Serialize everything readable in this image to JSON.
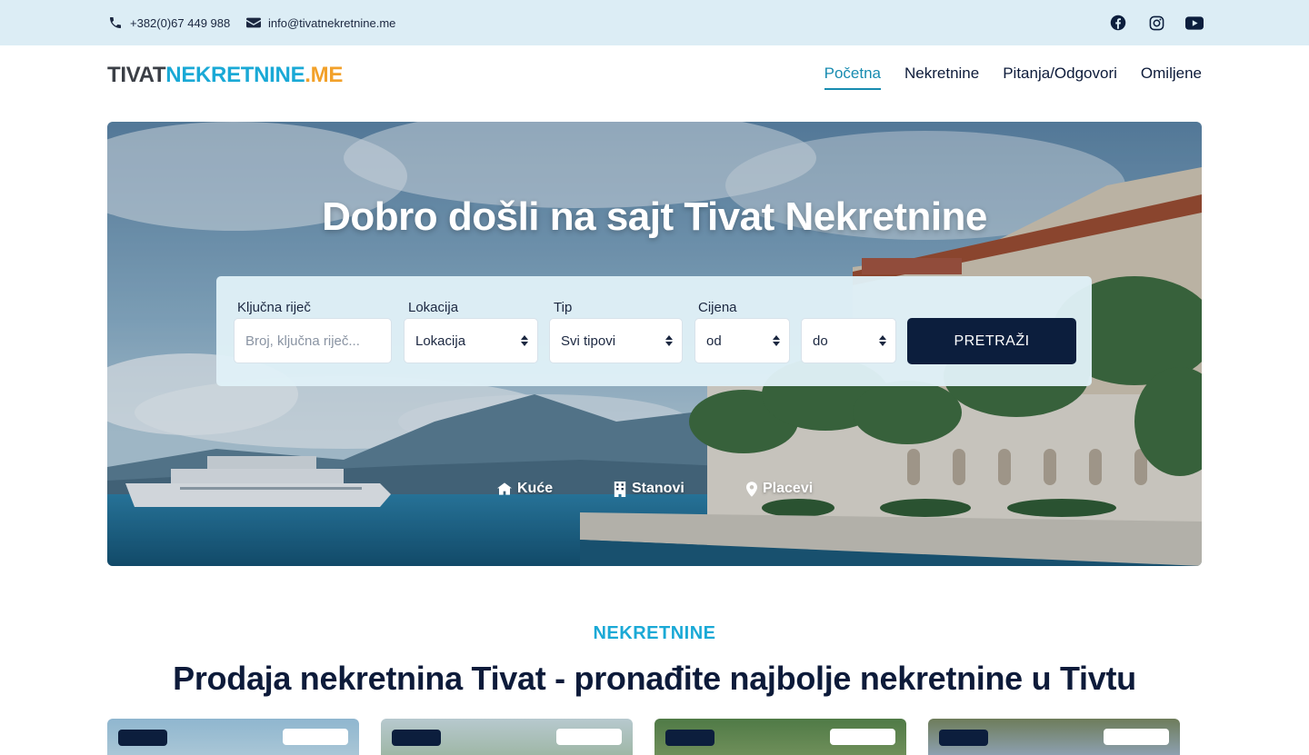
{
  "topbar": {
    "phone": "+382(0)67 449 988",
    "email": "info@tivatnekretnine.me",
    "socials": [
      "facebook-icon",
      "instagram-icon",
      "youtube-icon"
    ]
  },
  "header": {
    "logo": {
      "part1": "TIVAT",
      "part2": "NEKRETNINE",
      "part3": ".ME"
    },
    "nav": [
      {
        "label": "Početna",
        "active": true
      },
      {
        "label": "Nekretnine",
        "active": false
      },
      {
        "label": "Pitanja/Odgovori",
        "active": false
      },
      {
        "label": "Omiljene",
        "active": false
      }
    ]
  },
  "hero": {
    "title": "Dobro došli na sajt Tivat Nekretnine",
    "search": {
      "keyword_label": "Ključna riječ",
      "keyword_placeholder": "Broj, ključna riječ...",
      "location_label": "Lokacija",
      "location_value": "Lokacija",
      "type_label": "Tip",
      "type_value": "Svi tipovi",
      "price_label": "Cijena",
      "price_from": "od",
      "price_to": "do",
      "button": "PRETRAŽI"
    },
    "quick_links": [
      {
        "label": "Kuće",
        "icon": "house-icon"
      },
      {
        "label": "Stanovi",
        "icon": "building-icon"
      },
      {
        "label": "Placevi",
        "icon": "map-pin-icon"
      }
    ]
  },
  "section": {
    "eyebrow": "NEKRETNINE",
    "title": "Prodaja nekretnina Tivat - pronađite najbolje nekretnine u Tivtu"
  },
  "colors": {
    "accent": "#1aa9d6",
    "navy": "#0c1e3d",
    "topbar_bg": "#dcedf5",
    "logo_orange": "#f2a12a"
  }
}
